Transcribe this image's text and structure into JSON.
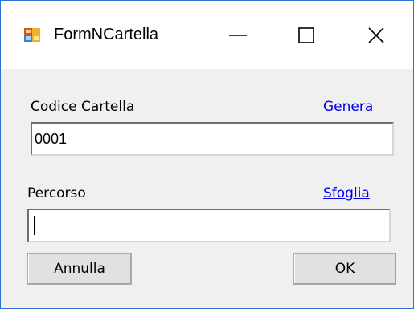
{
  "window": {
    "title": "FormNCartella",
    "icon": "windows-form-icon",
    "controls": {
      "minimize": "minimize-icon",
      "maximize": "maximize-icon",
      "close": "close-icon"
    }
  },
  "form": {
    "codice_label": "Codice Cartella",
    "genera_link": "Genera",
    "codice_value": "0001",
    "percorso_label": "Percorso",
    "sfoglia_link": "Sfoglia",
    "percorso_value": "",
    "annulla_button": "Annulla",
    "ok_button": "OK"
  },
  "colors": {
    "window_border": "#2b6fd6",
    "link": "#0000ee",
    "client_background": "#f0f0f0"
  }
}
